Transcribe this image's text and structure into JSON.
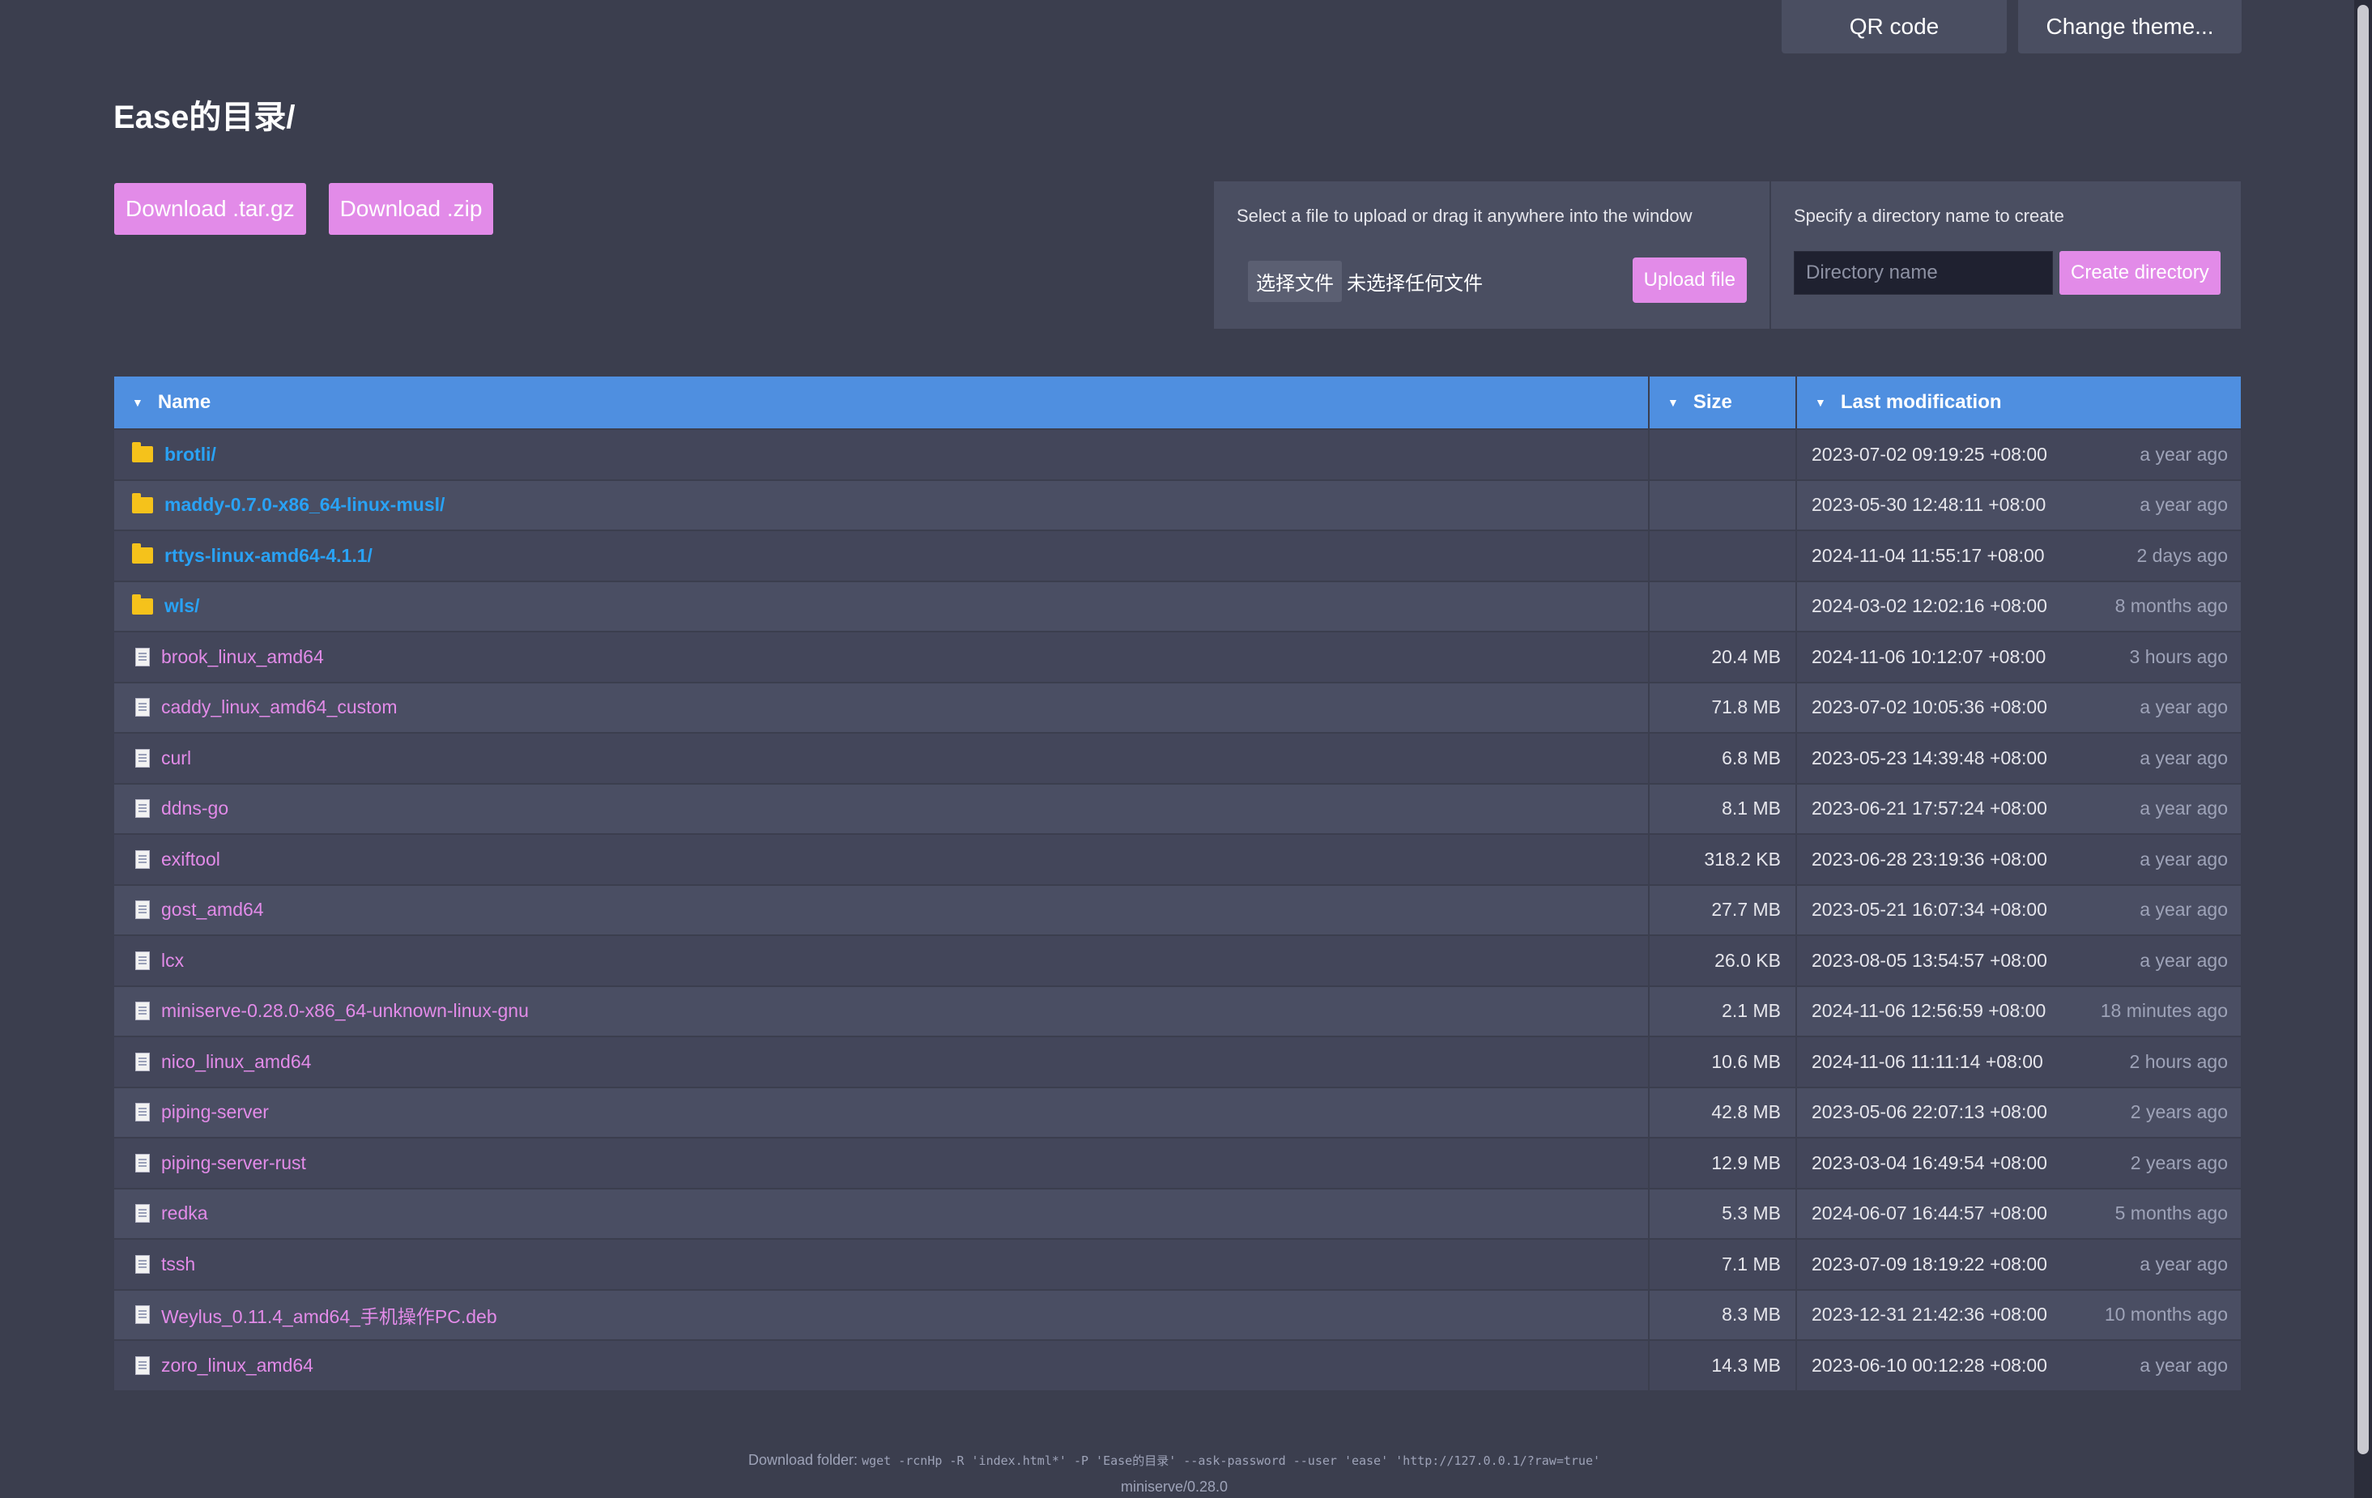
{
  "top": {
    "qr_label": "QR code",
    "theme_label": "Change theme..."
  },
  "title": "Ease的目录/",
  "downloads": {
    "targz_label": "Download .tar.gz",
    "zip_label": "Download .zip"
  },
  "upload": {
    "label": "Select a file to upload or drag it anywhere into the window",
    "choose_label": "选择文件",
    "no_file_label": "未选择任何文件",
    "upload_label": "Upload file"
  },
  "mkdir": {
    "label": "Specify a directory name to create",
    "placeholder": "Directory name",
    "create_label": "Create directory"
  },
  "table": {
    "headers": {
      "name": "Name",
      "size": "Size",
      "modified": "Last modification"
    },
    "rows": [
      {
        "type": "dir",
        "name": "brotli/",
        "size": "",
        "date": "2023-07-02 09:19:25 +08:00",
        "ago": "a year ago"
      },
      {
        "type": "dir",
        "name": "maddy-0.7.0-x86_64-linux-musl/",
        "size": "",
        "date": "2023-05-30 12:48:11 +08:00",
        "ago": "a year ago"
      },
      {
        "type": "dir",
        "name": "rttys-linux-amd64-4.1.1/",
        "size": "",
        "date": "2024-11-04 11:55:17 +08:00",
        "ago": "2 days ago"
      },
      {
        "type": "dir",
        "name": "wls/",
        "size": "",
        "date": "2024-03-02 12:02:16 +08:00",
        "ago": "8 months ago"
      },
      {
        "type": "file",
        "name": "brook_linux_amd64",
        "size": "20.4 MB",
        "date": "2024-11-06 10:12:07 +08:00",
        "ago": "3 hours ago"
      },
      {
        "type": "file",
        "name": "caddy_linux_amd64_custom",
        "size": "71.8 MB",
        "date": "2023-07-02 10:05:36 +08:00",
        "ago": "a year ago"
      },
      {
        "type": "file",
        "name": "curl",
        "size": "6.8 MB",
        "date": "2023-05-23 14:39:48 +08:00",
        "ago": "a year ago"
      },
      {
        "type": "file",
        "name": "ddns-go",
        "size": "8.1 MB",
        "date": "2023-06-21 17:57:24 +08:00",
        "ago": "a year ago"
      },
      {
        "type": "file",
        "name": "exiftool",
        "size": "318.2 KB",
        "date": "2023-06-28 23:19:36 +08:00",
        "ago": "a year ago"
      },
      {
        "type": "file",
        "name": "gost_amd64",
        "size": "27.7 MB",
        "date": "2023-05-21 16:07:34 +08:00",
        "ago": "a year ago"
      },
      {
        "type": "file",
        "name": "lcx",
        "size": "26.0 KB",
        "date": "2023-08-05 13:54:57 +08:00",
        "ago": "a year ago"
      },
      {
        "type": "file",
        "name": "miniserve-0.28.0-x86_64-unknown-linux-gnu",
        "size": "2.1 MB",
        "date": "2024-11-06 12:56:59 +08:00",
        "ago": "18 minutes ago"
      },
      {
        "type": "file",
        "name": "nico_linux_amd64",
        "size": "10.6 MB",
        "date": "2024-11-06 11:11:14 +08:00",
        "ago": "2 hours ago"
      },
      {
        "type": "file",
        "name": "piping-server",
        "size": "42.8 MB",
        "date": "2023-05-06 22:07:13 +08:00",
        "ago": "2 years ago"
      },
      {
        "type": "file",
        "name": "piping-server-rust",
        "size": "12.9 MB",
        "date": "2023-03-04 16:49:54 +08:00",
        "ago": "2 years ago"
      },
      {
        "type": "file",
        "name": "redka",
        "size": "5.3 MB",
        "date": "2024-06-07 16:44:57 +08:00",
        "ago": "5 months ago"
      },
      {
        "type": "file",
        "name": "tssh",
        "size": "7.1 MB",
        "date": "2023-07-09 18:19:22 +08:00",
        "ago": "a year ago"
      },
      {
        "type": "file",
        "name": "Weylus_0.11.4_amd64_手机操作PC.deb",
        "size": "8.3 MB",
        "date": "2023-12-31 21:42:36 +08:00",
        "ago": "10 months ago"
      },
      {
        "type": "file",
        "name": "zoro_linux_amd64",
        "size": "14.3 MB",
        "date": "2023-06-10 00:12:28 +08:00",
        "ago": "a year ago"
      }
    ]
  },
  "footer": {
    "label": "Download folder:",
    "command": "wget -rcnHp -R 'index.html*' -P 'Ease的目录' --ask-password --user 'ease' 'http://127.0.0.1/?raw=true'",
    "version": "miniserve/0.28.0"
  }
}
